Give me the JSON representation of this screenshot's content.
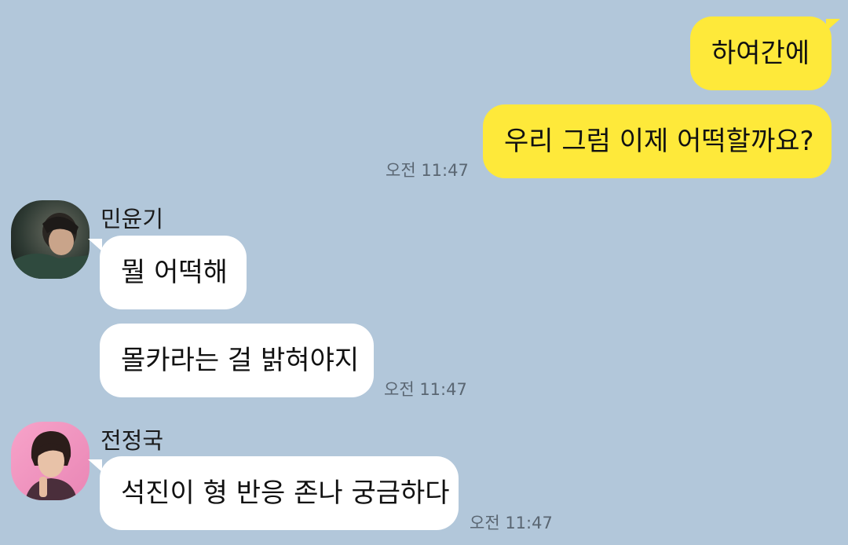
{
  "chat": {
    "background": "#b2c7da",
    "my_bubble_color": "#fee93a",
    "their_bubble_color": "#ffffff",
    "messages": [
      {
        "sender": "me",
        "text": "하여간에"
      },
      {
        "sender": "me",
        "text": "우리 그럼 이제 어떡할까요?",
        "time": "오전 11:47"
      },
      {
        "sender": "민윤기",
        "text": "뭘 어떡해"
      },
      {
        "sender": "민윤기",
        "text": "몰카라는 걸 밝혀야지",
        "time": "오전 11:47"
      },
      {
        "sender": "전정국",
        "text": "석진이 형 반응 존나 궁금하다",
        "time": "오전 11:47"
      }
    ],
    "participants": [
      {
        "name": "민윤기",
        "avatar": "profile-photo-dark"
      },
      {
        "name": "전정국",
        "avatar": "profile-photo-pink"
      }
    ]
  }
}
